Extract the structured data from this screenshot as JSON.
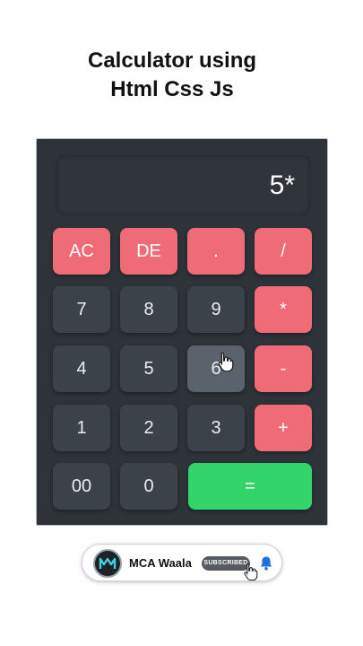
{
  "headline": {
    "line1": "Calculator using",
    "line2": "Html Css Js"
  },
  "calculator": {
    "display_value": "5*",
    "keys": {
      "ac": "AC",
      "de": "DE",
      "dot": ".",
      "divide": "/",
      "seven": "7",
      "eight": "8",
      "nine": "9",
      "multiply": "*",
      "four": "4",
      "five": "5",
      "six": "6",
      "minus": "-",
      "one": "1",
      "two": "2",
      "three": "3",
      "plus": "+",
      "double_zero": "00",
      "zero": "0",
      "equals": "="
    },
    "colors": {
      "body": "#2d3339",
      "key": "#3b4249",
      "operator": "#ef6b78",
      "equals": "#33d46a"
    }
  },
  "subscribe": {
    "channel_name": "MCA Waala",
    "button_label": "SUBSCRIBED",
    "icons": [
      "channel-avatar",
      "bell-icon",
      "hand-cursor-icon"
    ]
  }
}
